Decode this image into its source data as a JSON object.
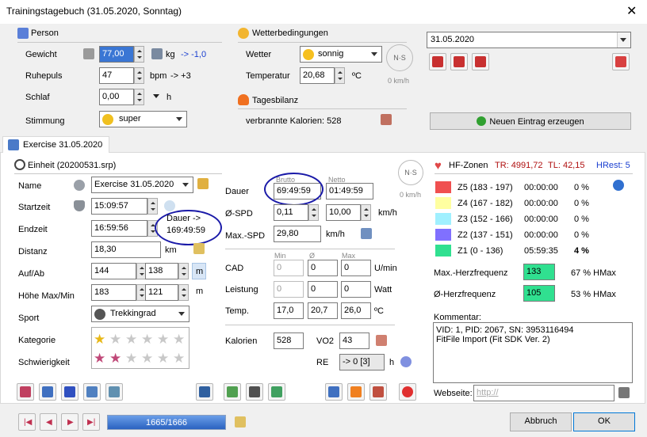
{
  "window": {
    "title": "Trainingstagebuch (31.05.2020, Sonntag)",
    "close": "✕"
  },
  "person": {
    "section": "Person",
    "gewicht_label": "Gewicht",
    "gewicht": "77,00",
    "gewicht_unit": "kg",
    "gewicht_delta": "-> -1,0",
    "ruhepuls_label": "Ruhepuls",
    "ruhepuls": "47",
    "ruhepuls_unit": "bpm",
    "ruhepuls_delta": "-> +3",
    "schlaf_label": "Schlaf",
    "schlaf": "0,00",
    "schlaf_unit": "h",
    "stimmung_label": "Stimmung",
    "stimmung": "super"
  },
  "wetter": {
    "section": "Wetterbedingungen",
    "wetter_label": "Wetter",
    "wetter": "sonnig",
    "temp_label": "Temperatur",
    "temp": "20,68",
    "temp_unit": "ºC",
    "wind": "0 km/h"
  },
  "tagesbilanz": {
    "section": "Tagesbilanz",
    "kalorien": "verbrannte Kalorien: 528"
  },
  "date": {
    "value": "31.05.2020"
  },
  "new_entry": "Neuen Eintrag erzeugen",
  "tab": "Exercise 31.05.2020",
  "einheit": {
    "section": "Einheit (20200531.srp)",
    "name_label": "Name",
    "name": "Exercise 31.05.2020",
    "startzeit_label": "Startzeit",
    "startzeit": "15:09:57",
    "endzeit_label": "Endzeit",
    "endzeit": "16:59:56",
    "dauer_tip": "Dauer ->",
    "dauer_tip_val": "169:49:59",
    "distanz_label": "Distanz",
    "distanz": "18,30",
    "distanz_unit": "km",
    "aufab_label": "Auf/Ab",
    "auf": "144",
    "ab": "138",
    "aufab_unit": "m",
    "hoehe_label": "Höhe Max/Min",
    "hoehe_max": "183",
    "hoehe_min": "121",
    "hoehe_unit": "m",
    "sport_label": "Sport",
    "sport": "Trekkingrad",
    "kategorie_label": "Kategorie",
    "schwierigkeit_label": "Schwierigkeit"
  },
  "mid": {
    "brutto": "Brutto",
    "netto": "Netto",
    "dauer_label": "Dauer",
    "dauer_brutto": "69:49:59",
    "dauer_netto": "01:49:59",
    "spd_label": "Ø-SPD",
    "spd_brutto": "0,11",
    "spd_netto": "10,00",
    "spd_unit": "km/h",
    "maxspd_label": "Max.-SPD",
    "maxspd": "29,80",
    "maxspd_unit": "km/h",
    "min": "Min",
    "avg": "Ø",
    "max": "Max",
    "cad_label": "CAD",
    "cad_min": "0",
    "cad_avg": "0",
    "cad_max": "0",
    "cad_unit": "U/min",
    "leistung_label": "Leistung",
    "leistung_min": "0",
    "leistung_avg": "0",
    "leistung_max": "0",
    "leistung_unit": "Watt",
    "temp_label": "Temp.",
    "temp_min": "17,0",
    "temp_avg": "20,7",
    "temp_max": "26,0",
    "temp_unit": "ºC",
    "kalorien_label": "Kalorien",
    "kalorien": "528",
    "vo2_label": "VO2",
    "vo2": "43",
    "re_label": "RE",
    "re": "-> 0 [3]",
    "re_unit": "h",
    "wind": "0 km/h"
  },
  "hf": {
    "section": "HF-Zonen",
    "tr": "TR: 4991,72",
    "tl": "TL: 42,15",
    "hrest": "HRest: 5",
    "zones": [
      {
        "name": "Z5 (183 - 197)",
        "time": "00:00:00",
        "pct": "0 %",
        "color": "#f05050"
      },
      {
        "name": "Z4 (167 - 182)",
        "time": "00:00:00",
        "pct": "0 %",
        "color": "#ffffa0"
      },
      {
        "name": "Z3 (152 - 166)",
        "time": "00:00:00",
        "pct": "0 %",
        "color": "#a0f0ff"
      },
      {
        "name": "Z2 (137 - 151)",
        "time": "00:00:00",
        "pct": "0 %",
        "color": "#8070ff"
      },
      {
        "name": "Z1 (0 - 136)",
        "time": "05:59:35",
        "pct": "4 %",
        "color": "#30e090"
      }
    ],
    "maxhf_label": "Max.-Herzfrequenz",
    "maxhf": "133",
    "maxhf_pct": "67 % HMax",
    "avghf_label": "Ø-Herzfrequenz",
    "avghf": "105",
    "avghf_pct": "53 % HMax",
    "hfcolor": "#30e090"
  },
  "kommentar": {
    "label": "Kommentar:",
    "line1": "VID: 1, PID: 2067, SN: 3953116494",
    "line2": "FitFile Import (Fit SDK Ver. 2)"
  },
  "webseite": {
    "label": "Webseite:",
    "placeholder": "http://"
  },
  "nav": {
    "progress": "1665/1666"
  },
  "footer": {
    "abbruch": "Abbruch",
    "ok": "OK"
  }
}
